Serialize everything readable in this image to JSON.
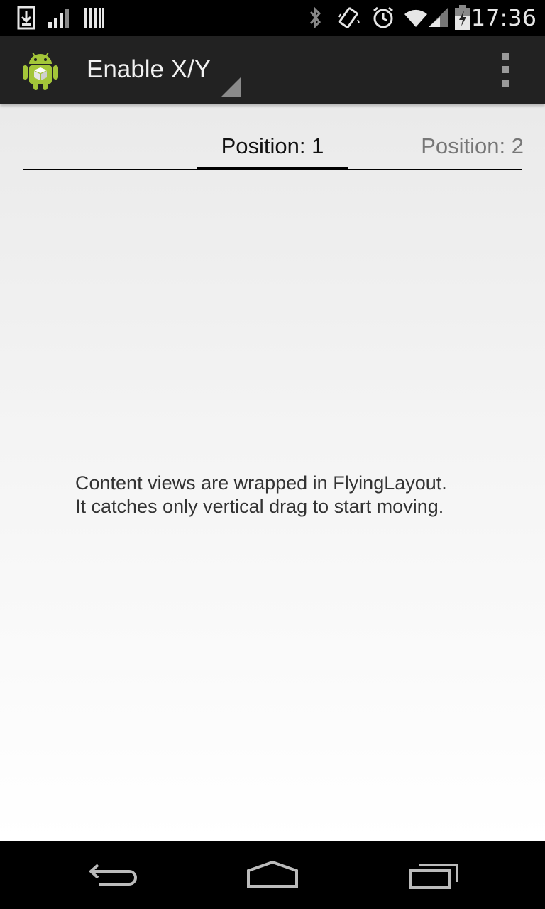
{
  "status_bar": {
    "time": "17:36",
    "icons": [
      "download-icon",
      "signal-bars-icon",
      "barcode-icon",
      "bluetooth-icon",
      "vibrate-icon",
      "alarm-icon",
      "wifi-icon",
      "cell-signal-icon",
      "battery-charging-icon"
    ]
  },
  "action_bar": {
    "title": "Enable X/Y",
    "app_icon": "android-robot-icon",
    "spinner_icon": "spinner-arrow-icon",
    "menu_icon": "overflow-menu-icon"
  },
  "tabs": [
    {
      "label": "Position: 1",
      "selected": true
    },
    {
      "label": "Position: 2",
      "selected": false
    }
  ],
  "content": {
    "line1": "Content views are wrapped in FlyingLayout.",
    "line2": "It catches only vertical drag to start moving."
  },
  "nav_bar": {
    "icons": [
      "back-icon",
      "home-icon",
      "recent-apps-icon"
    ]
  },
  "colors": {
    "action_bar_bg": "#222222",
    "status_bar_bg": "#000000",
    "tab_indicator": "#000000",
    "android_green": "#a4c639"
  }
}
